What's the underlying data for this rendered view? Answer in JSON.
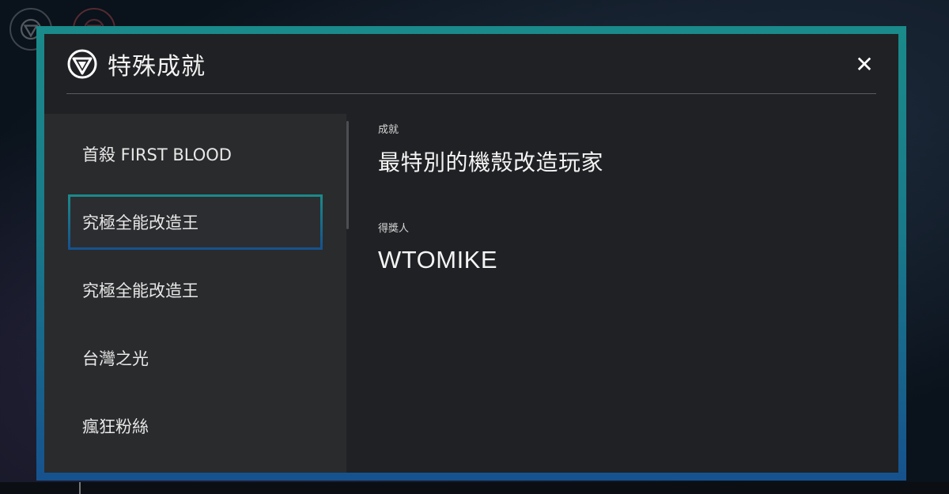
{
  "modal": {
    "title": "特殊成就",
    "close_label": "✕"
  },
  "achievements": [
    {
      "label": "首殺 FIRST BLOOD",
      "selected": false
    },
    {
      "label": "究極全能改造王",
      "selected": true
    },
    {
      "label": "究極全能改造王",
      "selected": false
    },
    {
      "label": "台灣之光",
      "selected": false
    },
    {
      "label": "瘋狂粉絲",
      "selected": false
    }
  ],
  "detail": {
    "achievement_label": "成就",
    "achievement_value": "最特別的機殼改造玩家",
    "winner_label": "得獎人",
    "winner_value": "WTOMIKE"
  },
  "icons": {
    "brand": "brand-logo-icon",
    "close": "close-icon"
  },
  "colors": {
    "frame_top": "#1a8a8a",
    "frame_bottom": "#16528e",
    "panel_bg": "#202124",
    "list_bg": "#2a2b2d"
  }
}
